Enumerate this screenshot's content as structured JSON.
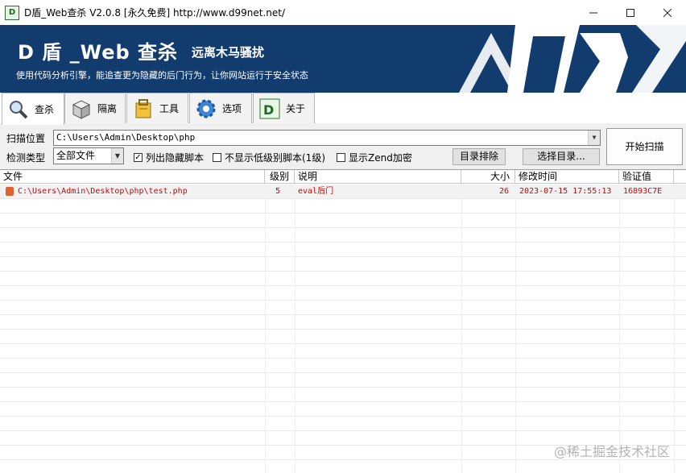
{
  "window": {
    "title": "D盾_Web查杀 V2.0.8 [永久免费] http://www.d99net.net/",
    "icon_text": "D",
    "controls": [
      "minimize-icon",
      "maximize-icon",
      "close-icon"
    ]
  },
  "banner": {
    "title": "D 盾 _Web 查杀",
    "slogan": "远离木马骚扰",
    "subtitle": "使用代码分析引擎，能追查更为隐藏的后门行为，让你网站运行于安全状态",
    "bg_color": "#123c6e"
  },
  "tabs": [
    {
      "label": "查杀",
      "icon": "magnifier-icon",
      "active": true
    },
    {
      "label": "隔离",
      "icon": "box-icon",
      "active": false
    },
    {
      "label": "工具",
      "icon": "toolbox-icon",
      "active": false
    },
    {
      "label": "选项",
      "icon": "gear-icon",
      "active": false
    },
    {
      "label": "关于",
      "icon": "d-logo-icon",
      "active": false
    }
  ],
  "controls": {
    "scan_location_label": "扫描位置",
    "scan_path": "C:\\Users\\Admin\\Desktop\\php",
    "detect_type_label": "检测类型",
    "detect_type_value": "全部文件",
    "chk_hidden_label": "列出隐藏脚本",
    "chk_hidden_checked": true,
    "chk_lowlevel_label": "不显示低级别脚本(1级)",
    "chk_lowlevel_checked": false,
    "chk_zend_label": "显示Zend加密",
    "chk_zend_checked": false,
    "exclude_dir_button": "目录排除",
    "choose_dir_button": "选择目录...",
    "start_scan_button": "开始扫描"
  },
  "table": {
    "columns": [
      "文件",
      "级别",
      "说明",
      "大小",
      "修改时间",
      "验证值"
    ],
    "rows": [
      {
        "file": "C:\\Users\\Admin\\Desktop\\php\\test.php",
        "level": "5",
        "desc": "eval后门",
        "size": "26",
        "mtime": "2023-07-15 17:55:13",
        "hash": "16893C7E"
      }
    ],
    "row_text_color": "#d40000"
  },
  "watermark": "@稀土掘金技术社区"
}
